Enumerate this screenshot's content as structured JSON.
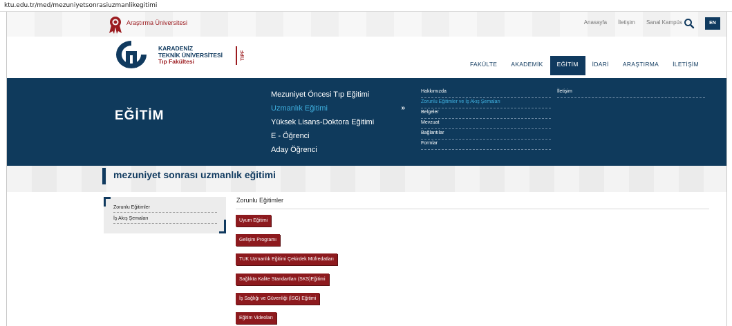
{
  "browser": {
    "url": "ktu.edu.tr/med/mezuniyetsonrasiuzmanlikegitimi"
  },
  "topbar": {
    "research_label": "Araştırma Üniversitesi",
    "links": [
      "Anasayfa",
      "İletişim",
      "Sanal Kampüs"
    ],
    "language_button": "EN",
    "search_icon": "search-icon"
  },
  "logo": {
    "line1": "KARADENİZ",
    "line2": "TEKNİK ÜNİVERSİTESİ",
    "line3": "Tıp Fakültesi",
    "vertical_label": "TIPF"
  },
  "main_nav": [
    {
      "label": "FAKÜLTE",
      "active": false
    },
    {
      "label": "AKADEMİK",
      "active": false
    },
    {
      "label": "EĞİTİM",
      "active": true
    },
    {
      "label": "İDARİ",
      "active": false
    },
    {
      "label": "ARAŞTIRMA",
      "active": false
    },
    {
      "label": "İLETİŞİM",
      "active": false
    }
  ],
  "mega_menu": {
    "title": "EĞİTİM",
    "primary": [
      {
        "label": "Mezuniyet Öncesi Tıp Eğitimi",
        "active": false
      },
      {
        "label": "Uzmanlık Eğitimi",
        "active": true,
        "arrow": "»"
      },
      {
        "label": "Yüksek Lisans-Doktora Eğitimi",
        "active": false
      },
      {
        "label": "E - Öğrenci",
        "active": false
      },
      {
        "label": "Aday Öğrenci",
        "active": false
      }
    ],
    "secondary": [
      {
        "label": "Hakkımızda",
        "active": false
      },
      {
        "label": "Zorunlu Eğitimler ve İş Akış Şemaları",
        "active": true
      },
      {
        "label": "Belgeler",
        "active": false
      },
      {
        "label": "Mevzuat",
        "active": false
      },
      {
        "label": "Bağlantılar",
        "active": false
      },
      {
        "label": "Formlar",
        "active": false
      }
    ],
    "tertiary": [
      {
        "label": "İletişim"
      }
    ]
  },
  "page": {
    "title": "mezuniyet sonrası uzmanlık eğitimi"
  },
  "sidebar": {
    "items": [
      {
        "label": "Zorunlu Eğitimler"
      },
      {
        "label": "İş Akış Şemaları"
      }
    ]
  },
  "content": {
    "heading": "Zorunlu Eğitimler",
    "buttons": [
      "Uyum Eğitimi",
      "Gelişim Programı",
      "TUK Uzmanlık Eğitimi Çekirdek Müfredatları",
      "Sağlıkta Kalite Standartları (SKS)Eğitimi",
      "İş Sağlığı ve Güvenliği (İSG) Eğitimi",
      "Eğitim Videoları"
    ]
  },
  "colors": {
    "navy": "#103a5f",
    "mega_bg": "#0f3a5c",
    "accent_red": "#8d1a1e",
    "active_link": "#3fb0df"
  }
}
